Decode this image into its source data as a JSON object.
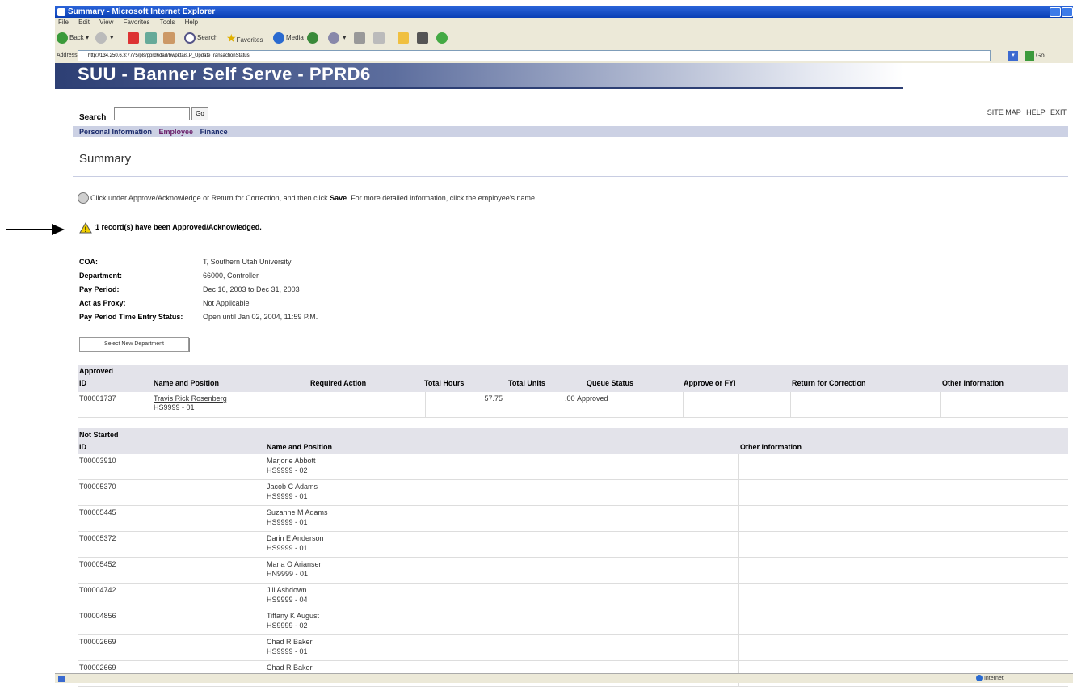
{
  "window": {
    "title": "Summary - Microsoft Internet Explorer",
    "menus": [
      "File",
      "Edit",
      "View",
      "Favorites",
      "Tools",
      "Help"
    ],
    "toolbar": {
      "back": "Back",
      "search": "Search",
      "favorites": "Favorites",
      "media": "Media"
    },
    "address_label": "Address",
    "address": "http://134.250.6.3:7775/pls/pprd6dad/bwpktais.P_UpdateTransactionStatus",
    "go": "Go",
    "status_zone": "Internet"
  },
  "banner": {
    "title": "SUU - Banner Self Serve - PPRD6"
  },
  "search": {
    "label": "Search",
    "value": "",
    "go": "Go"
  },
  "toplinks": [
    "SITE MAP",
    "HELP",
    "EXIT"
  ],
  "nav": [
    "Personal Information",
    "Employee",
    "Finance"
  ],
  "page_title": "Summary",
  "info": {
    "pre": "Click under Approve/Acknowledge or Return for Correction, and then click ",
    "bold": "Save",
    "post": ". For more detailed information, click the employee's name."
  },
  "warning": "1 record(s) have been Approved/Acknowledged.",
  "key_info": [
    {
      "label": "COA:",
      "value": "T, Southern Utah University"
    },
    {
      "label": "Department:",
      "value": "66000, Controller"
    },
    {
      "label": "Pay Period:",
      "value": "Dec 16, 2003 to Dec 31, 2003"
    },
    {
      "label": "Act as Proxy:",
      "value": "Not Applicable"
    },
    {
      "label": "Pay Period Time Entry Status:",
      "value": "Open until Jan 02, 2004, 11:59 P.M."
    }
  ],
  "select_department": "Select New Department",
  "approved": {
    "caption": "Approved",
    "headers": [
      "ID",
      "Name and Position",
      "Required Action",
      "Total Hours",
      "Total Units",
      "Queue Status",
      "Approve or FYI",
      "Return for Correction",
      "Other Information"
    ],
    "rows": [
      {
        "id": "T00001737",
        "name": "Travis Rick Rosenberg",
        "position": "HS9999 - 01",
        "required_action": "",
        "total_hours": "57.75",
        "total_units": ".00",
        "queue_status": "Approved"
      }
    ]
  },
  "not_started": {
    "caption": "Not Started",
    "headers": [
      "ID",
      "Name and Position",
      "Other Information"
    ],
    "rows": [
      {
        "id": "T00003910",
        "name": "Marjorie Abbott",
        "position": "HS9999 - 02"
      },
      {
        "id": "T00005370",
        "name": "Jacob C Adams",
        "position": "HS9999 - 01"
      },
      {
        "id": "T00005445",
        "name": "Suzanne M Adams",
        "position": "HS9999 - 01"
      },
      {
        "id": "T00005372",
        "name": "Darin E Anderson",
        "position": "HS9999 - 01"
      },
      {
        "id": "T00005452",
        "name": "Maria O Ariansen",
        "position": "HN9999 - 01"
      },
      {
        "id": "T00004742",
        "name": "Jill Ashdown",
        "position": "HS9999 - 04"
      },
      {
        "id": "T00004856",
        "name": "Tiffany K August",
        "position": "HS9999 - 02"
      },
      {
        "id": "T00002669",
        "name": "Chad R Baker",
        "position": "HS9999 - 01"
      },
      {
        "id": "T00002669",
        "name": "Chad R Baker",
        "position": ""
      }
    ]
  }
}
